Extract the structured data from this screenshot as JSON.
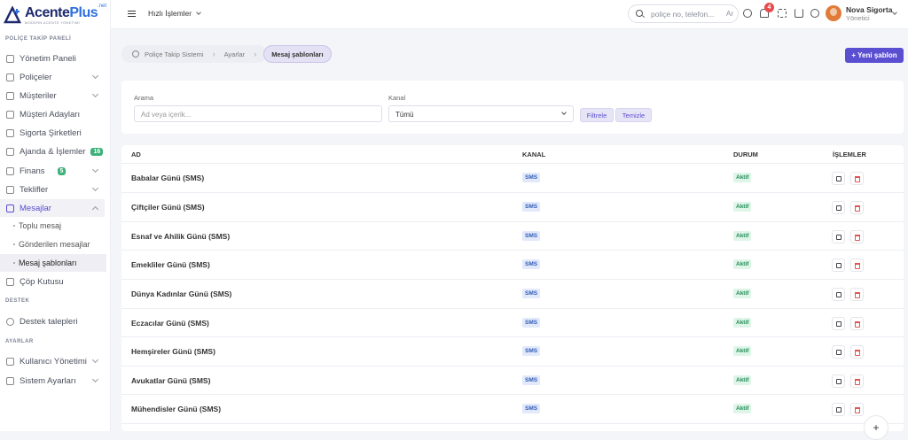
{
  "brand": {
    "name_a": "Acente",
    "name_b": "Plus",
    "net": ".net",
    "tagline": "MODERN ACENTE YÖNETİMİ",
    "accent": "#5b4fd1"
  },
  "sidebar": {
    "section_policy": "POLİÇE TAKİP PANELİ",
    "section_support": "DESTEK",
    "section_settings": "AYARLAR",
    "items": [
      {
        "label": "Yönetim Paneli"
      },
      {
        "label": "Poliçeler"
      },
      {
        "label": "Müşteriler"
      },
      {
        "label": "Müşteri Adayları"
      },
      {
        "label": "Sigorta Şirketleri"
      },
      {
        "label": "Ajanda & İşlemler",
        "badge": "16"
      },
      {
        "label": "Finans",
        "badge": "5"
      },
      {
        "label": "Teklifler"
      },
      {
        "label": "Mesajlar"
      },
      {
        "label": "Çöp Kutusu"
      },
      {
        "label": "Destek talepleri"
      },
      {
        "label": "Kullanıcı Yönetimi"
      },
      {
        "label": "Sistem Ayarları"
      }
    ],
    "sub_items": [
      {
        "label": "Toplu mesaj"
      },
      {
        "label": "Gönderilen mesajlar"
      },
      {
        "label": "Mesaj şablonları"
      }
    ]
  },
  "topbar": {
    "quick": "Hızlı İşlemler",
    "search_placeholder": "poliçe no, telefon...",
    "search_kbd": "Ar",
    "notif_count": "4",
    "user_name": "Nova Sigorta",
    "user_role": "Yönetici"
  },
  "breadcrumb": {
    "home": "Poliçe Takip Sistemi",
    "mid": "Ayarlar",
    "current": "Mesaj şablonları"
  },
  "new_button": "+ Yeni şablon",
  "filter": {
    "search_label": "Arama",
    "search_placeholder": "Ad veya içerik...",
    "channel_label": "Kanal",
    "channel_value": "Tümü",
    "filter_btn": "Filtrele",
    "clear_btn": "Temizle"
  },
  "table": {
    "headers": {
      "name": "AD",
      "channel": "KANAL",
      "status": "DURUM",
      "actions": "İŞLEMLER"
    },
    "rows": [
      {
        "name": "Babalar Günü (SMS)",
        "channel": "SMS",
        "status": "Aktif"
      },
      {
        "name": "Çiftçiler Günü (SMS)",
        "channel": "SMS",
        "status": "Aktif"
      },
      {
        "name": "Esnaf ve Ahilik Günü (SMS)",
        "channel": "SMS",
        "status": "Aktif"
      },
      {
        "name": "Emekliler Günü (SMS)",
        "channel": "SMS",
        "status": "Aktif"
      },
      {
        "name": "Dünya Kadınlar Günü (SMS)",
        "channel": "SMS",
        "status": "Aktif"
      },
      {
        "name": "Eczacılar Günü (SMS)",
        "channel": "SMS",
        "status": "Aktif"
      },
      {
        "name": "Hemşireler Günü (SMS)",
        "channel": "SMS",
        "status": "Aktif"
      },
      {
        "name": "Avukatlar Günü (SMS)",
        "channel": "SMS",
        "status": "Aktif"
      },
      {
        "name": "Mühendisler Günü (SMS)",
        "channel": "SMS",
        "status": "Aktif"
      }
    ]
  },
  "fab": "+"
}
